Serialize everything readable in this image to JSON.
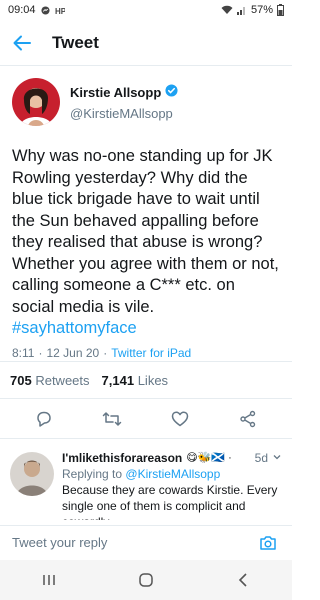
{
  "status_bar": {
    "time": "09:04",
    "battery": "57%",
    "icons": [
      "wifi-icon",
      "signal-icon",
      "battery-icon"
    ]
  },
  "header": {
    "title": "Tweet",
    "back_icon": "back-arrow-icon"
  },
  "tweet": {
    "author_name": "Kirstie Allsopp",
    "author_handle": "@KirstieMAllsopp",
    "verified": true,
    "text": "Why was no-one standing up for JK Rowling yesterday? Why did the blue tick brigade have to wait until the Sun behaved appalling before they realised that abuse is wrong? Whether you agree with them or not, calling someone a C*** etc. on social media is vile.",
    "hashtag": "#sayhattomyface",
    "time": "8:11",
    "dot": "·",
    "date": "12 Jun 20",
    "source": "Twitter for iPad"
  },
  "stats": {
    "retweets_count": "705",
    "retweets_label": "Retweets",
    "likes_count": "7,141",
    "likes_label": "Likes"
  },
  "actions": [
    "reply-icon",
    "retweet-icon",
    "like-icon",
    "share-icon"
  ],
  "reply": {
    "name": "I'mlikethisforareason",
    "emoji": "😋🐝🏴󠁧󠁢󠁳󠁣󠁴󠁿 ·",
    "time": "5d",
    "replying_prefix": "Replying to",
    "replying_handle": "@KirstieMAllsopp",
    "text": "Because they are cowards Kirstie. Every single one of them is complicit and cowardly"
  },
  "compose": {
    "placeholder": "Tweet your reply"
  },
  "colors": {
    "accent": "#1da1f2",
    "text": "#14171a",
    "secondary": "#657786"
  }
}
